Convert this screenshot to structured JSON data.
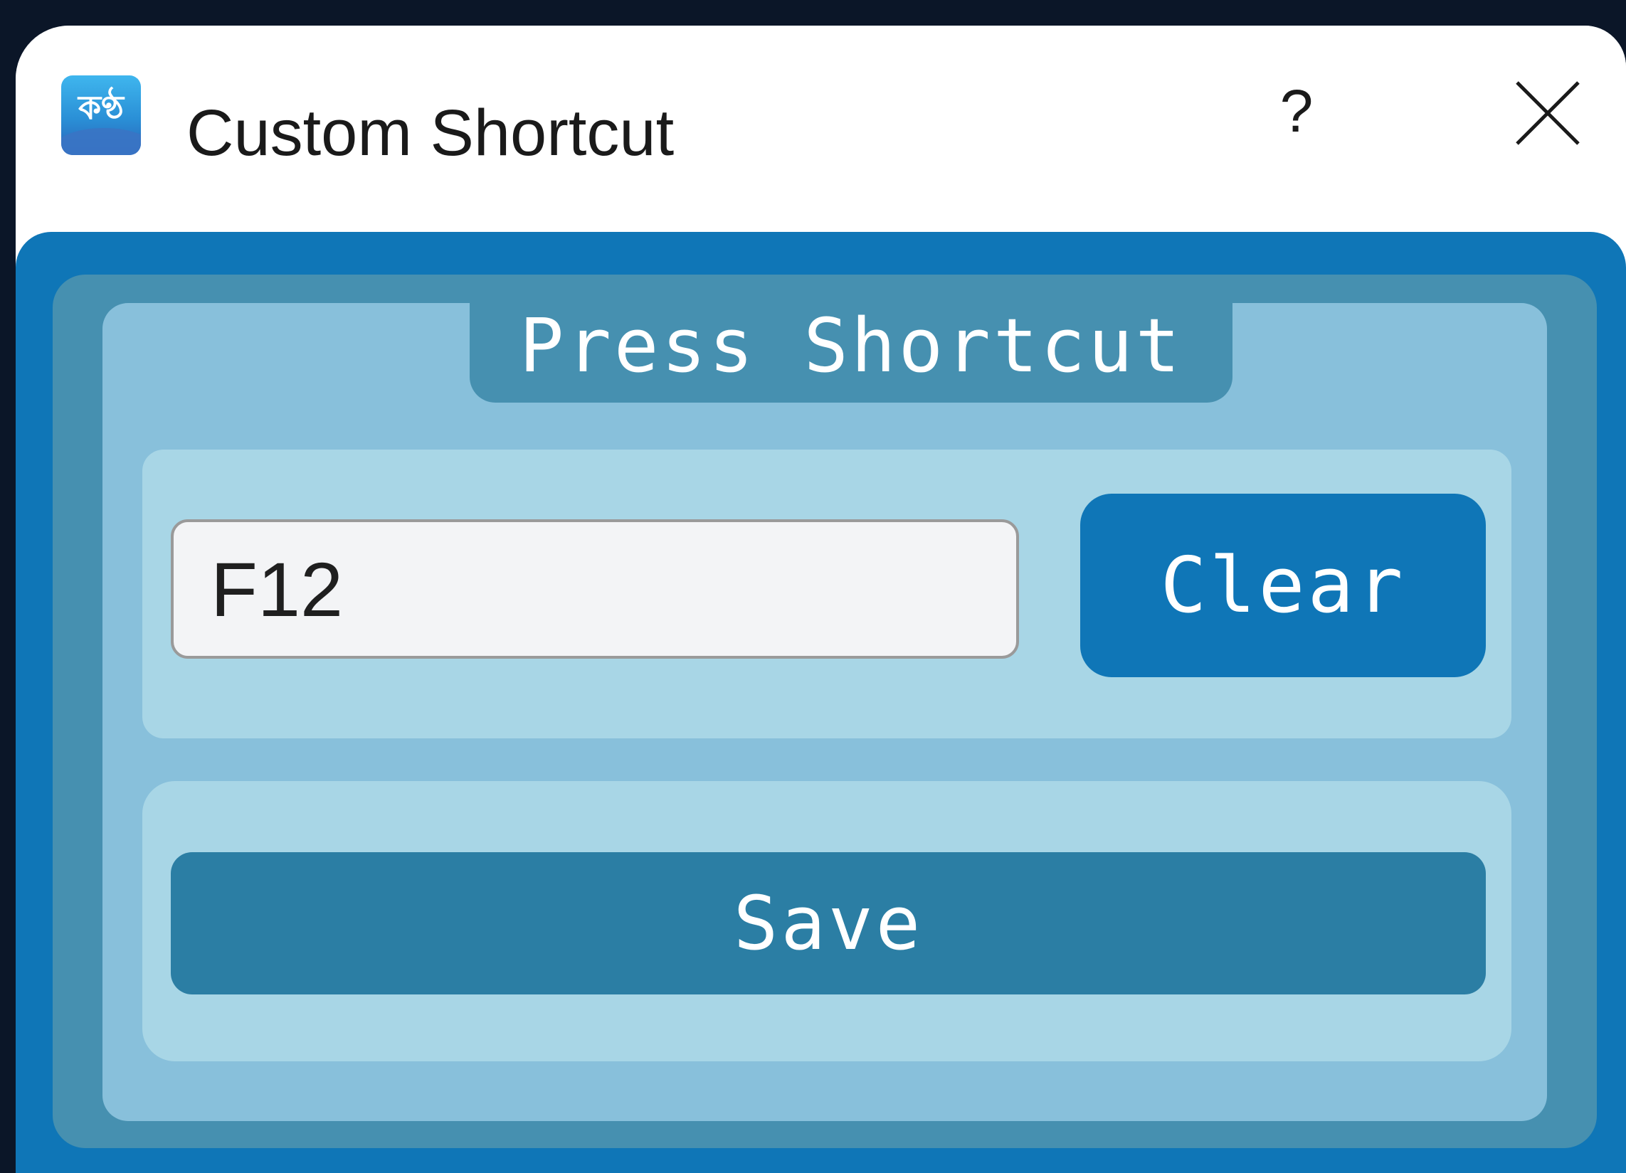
{
  "window": {
    "title": "Custom Shortcut",
    "app_icon": {
      "name": "app-logo-icon",
      "glyph": "কণ্ঠ"
    },
    "help_label": "?",
    "help_icon": "question-mark-icon",
    "close_icon": "close-icon"
  },
  "group": {
    "title": "Press Shortcut"
  },
  "shortcut_input": {
    "value": "F12",
    "placeholder": ""
  },
  "buttons": {
    "clear_label": "Clear",
    "save_label": "Save"
  },
  "colors": {
    "frame": "#0f76b7",
    "outer_panel": "#4690b0",
    "group_box": "#88c0db",
    "row_panel": "#a8d6e6",
    "clear_button": "#0f76b7",
    "save_button": "#2b7ea4",
    "input_background": "#f3f4f6"
  }
}
